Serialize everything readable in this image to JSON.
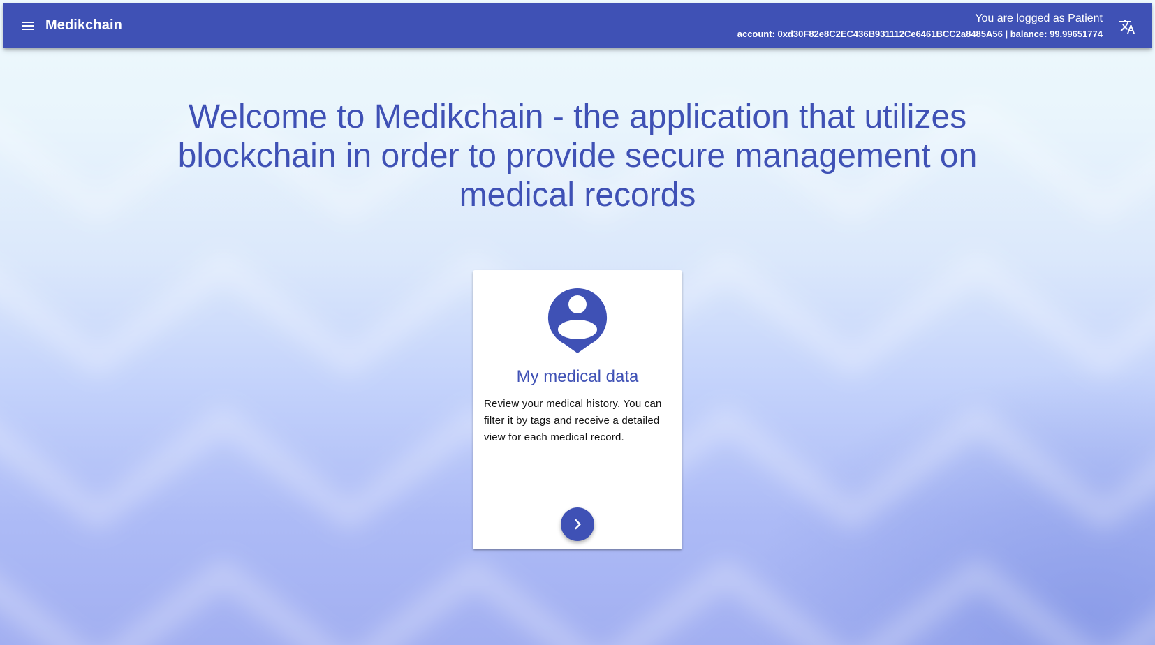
{
  "app": {
    "title": "Medikchain"
  },
  "header": {
    "logged_as": "You are logged as Patient",
    "account_line": "account: 0xd30F82e8C2EC436B931112Ce6461BCC2a8485A56 | balance: 99.99651774",
    "menu_icon": "menu-icon",
    "translate_icon": "translate-icon"
  },
  "main": {
    "welcome": "Welcome to Medikchain - the application that utilizes blockchain in order to provide secure management on medical records"
  },
  "cards": [
    {
      "icon": "person-pin-icon",
      "title": "My medical data",
      "description": "Review your medical history. You can filter it by tags and receive a detailed view for each medical record.",
      "action_icon": "chevron-right-icon"
    }
  ],
  "colors": {
    "primary": "#3f51b5",
    "card_background": "#ffffff"
  }
}
